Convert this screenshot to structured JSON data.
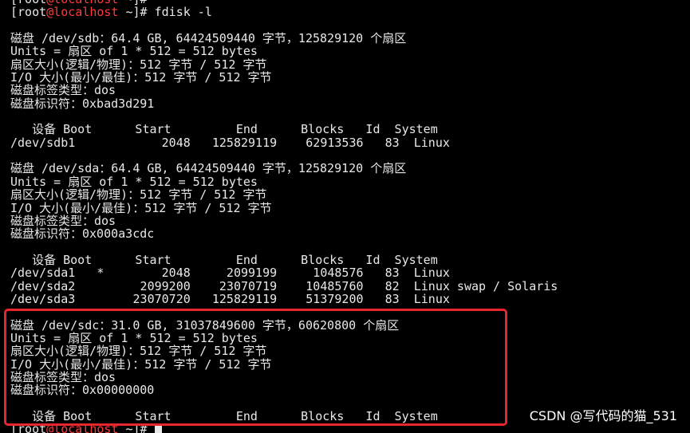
{
  "prompt": {
    "user": "root",
    "at": "@",
    "host": "localhost",
    "path": " ~"
  },
  "command": "fdisk -l",
  "terminal_lines": [
    {
      "type": "prompt",
      "text": "]# "
    },
    {
      "type": "prompt",
      "text": "]# fdisk -l"
    },
    {
      "type": "text",
      "text": ""
    },
    {
      "type": "text",
      "text": "磁盘 /dev/sdb：64.4 GB, 64424509440 字节，125829120 个扇区"
    },
    {
      "type": "text",
      "text": "Units = 扇区 of 1 * 512 = 512 bytes"
    },
    {
      "type": "text",
      "text": "扇区大小(逻辑/物理)：512 字节 / 512 字节"
    },
    {
      "type": "text",
      "text": "I/O 大小(最小/最佳)：512 字节 / 512 字节"
    },
    {
      "type": "text",
      "text": "磁盘标签类型：dos"
    },
    {
      "type": "text",
      "text": "磁盘标识符：0xbad3d291"
    },
    {
      "type": "text",
      "text": ""
    },
    {
      "type": "text",
      "text": "   设备 Boot      Start         End      Blocks   Id  System"
    },
    {
      "type": "text",
      "text": "/dev/sdb1            2048   125829119    62913536   83  Linux"
    },
    {
      "type": "text",
      "text": ""
    },
    {
      "type": "text",
      "text": "磁盘 /dev/sda：64.4 GB, 64424509440 字节，125829120 个扇区"
    },
    {
      "type": "text",
      "text": "Units = 扇区 of 1 * 512 = 512 bytes"
    },
    {
      "type": "text",
      "text": "扇区大小(逻辑/物理)：512 字节 / 512 字节"
    },
    {
      "type": "text",
      "text": "I/O 大小(最小/最佳)：512 字节 / 512 字节"
    },
    {
      "type": "text",
      "text": "磁盘标签类型：dos"
    },
    {
      "type": "text",
      "text": "磁盘标识符：0x000a3cdc"
    },
    {
      "type": "text",
      "text": ""
    },
    {
      "type": "text",
      "text": "   设备 Boot      Start         End      Blocks   Id  System"
    },
    {
      "type": "text",
      "text": "/dev/sda1   *        2048     2099199     1048576   83  Linux"
    },
    {
      "type": "text",
      "text": "/dev/sda2         2099200    23070719    10485760   82  Linux swap / Solaris"
    },
    {
      "type": "text",
      "text": "/dev/sda3        23070720   125829119    51379200   83  Linux"
    },
    {
      "type": "text",
      "text": ""
    },
    {
      "type": "text",
      "text": "磁盘 /dev/sdc：31.0 GB, 31037849600 字节，60620800 个扇区"
    },
    {
      "type": "text",
      "text": "Units = 扇区 of 1 * 512 = 512 bytes"
    },
    {
      "type": "text",
      "text": "扇区大小(逻辑/物理)：512 字节 / 512 字节"
    },
    {
      "type": "text",
      "text": "I/O 大小(最小/最佳)：512 字节 / 512 字节"
    },
    {
      "type": "text",
      "text": "磁盘标签类型：dos"
    },
    {
      "type": "text",
      "text": "磁盘标识符：0x00000000"
    },
    {
      "type": "text",
      "text": ""
    },
    {
      "type": "text",
      "text": "   设备 Boot      Start         End      Blocks   Id  System"
    },
    {
      "type": "prompt",
      "text": "]# ",
      "cursor": true
    }
  ],
  "highlight_color": "#e8262d",
  "prompt_host_color": "#ff3b3b",
  "watermark": "CSDN @写代码的猫_531"
}
